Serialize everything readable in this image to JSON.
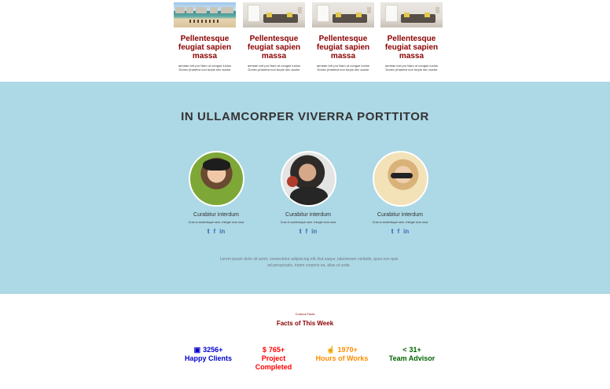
{
  "cards": [
    {
      "image": "beach",
      "title": "Pellentesque feugiat sapien massa",
      "text": "aenean tort pur Nam ut congue luctus Donec pharetra non turpis nec auctor"
    },
    {
      "image": "room",
      "title": "Pellentesque feugiat sapien massa",
      "text": "aenean tort pur Nam ut congue luctus Donec pharetra non turpis nec auctor"
    },
    {
      "image": "room",
      "title": "Pellentesque feugiat sapien massa",
      "text": "aenean tort pur Nam ut congue luctus Donec pharetra non turpis nec auctor"
    },
    {
      "image": "room",
      "title": "Pellentesque feugiat sapien massa",
      "text": "aenean tort pur Nam ut congue luctus Donec pharetra non turpis nec auctor"
    }
  ],
  "team": {
    "title": "IN ULLAMCORPER VIVERRA PORTTITOR",
    "members": [
      {
        "name": "Curabitur interdum",
        "subtitle": "Cras in scelerisque sem. Integer erat urna",
        "social": [
          "twitter-icon",
          "facebook-icon",
          "linkedin-icon"
        ]
      },
      {
        "name": "Curabitur interdum",
        "subtitle": "Cras in scelerisque sem. Integer erat urna",
        "social": [
          "twitter-icon",
          "facebook-icon",
          "linkedin-icon"
        ]
      },
      {
        "name": "Curabitur interdum",
        "subtitle": "Cras in scelerisque sem. Integer erat urna",
        "social": [
          "twitter-icon",
          "facebook-icon",
          "linkedin-icon"
        ]
      }
    ],
    "blurb": "Lorem ipsum dolor sit amet, consectetur adipisicing elit. Aut eaque, laboriosam veritatis, quos non quis ad perspiciatis, totam corporis ea, alias ut unde."
  },
  "facts": {
    "kicker": "Curious Facts",
    "title": "Facts of This Week",
    "items": [
      {
        "icon": "car-icon",
        "value": "3256+",
        "label": "Happy Clients",
        "color": "#0000cd"
      },
      {
        "icon": "dollar-icon",
        "value": "765+",
        "label": "Project Completed",
        "color": "#ff0000"
      },
      {
        "icon": "thumbs-up-icon",
        "value": "1970+",
        "label": "Hours of Works",
        "color": "#ff8c00"
      },
      {
        "icon": "share-icon",
        "value": "31+",
        "label": "Team Advisor",
        "color": "#006400"
      }
    ]
  }
}
